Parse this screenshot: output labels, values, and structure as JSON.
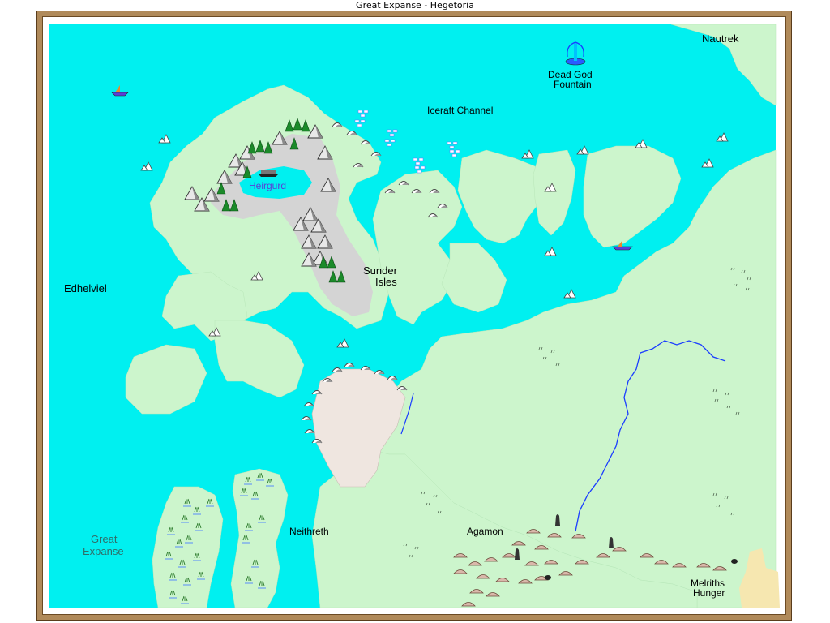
{
  "window": {
    "title": "Great Expanse - Hegetoria"
  },
  "labels": {
    "nautrek": "Nautrek",
    "dead_god_1": "Dead God",
    "dead_god_2": "Fountain",
    "iceraft": "Iceraft Channel",
    "heirgurd": "Heirgurd",
    "sunder_1": "Sunder",
    "sunder_2": "Isles",
    "edhelviel": "Edhelviel",
    "great_1": "Great",
    "great_2": "Expanse",
    "neithreth": "Neithreth",
    "agamon": "Agamon",
    "melriths_1": "Melriths",
    "melriths_2": "Hunger"
  },
  "colors": {
    "water": "#00f0f0",
    "land": "#ccf5cc",
    "mountain_range": "#d4d4d4",
    "desert": "#efe6e0",
    "frame": "#b08a5a",
    "river": "#1a3cff",
    "sand": "#f6e7b0"
  },
  "icons": [
    "ship-icon",
    "fountain-icon",
    "iceberg-icon",
    "mountain-icon",
    "tree-icon",
    "marsh-icon",
    "grass-icon",
    "hill-icon",
    "tower-icon",
    "cave-icon"
  ]
}
